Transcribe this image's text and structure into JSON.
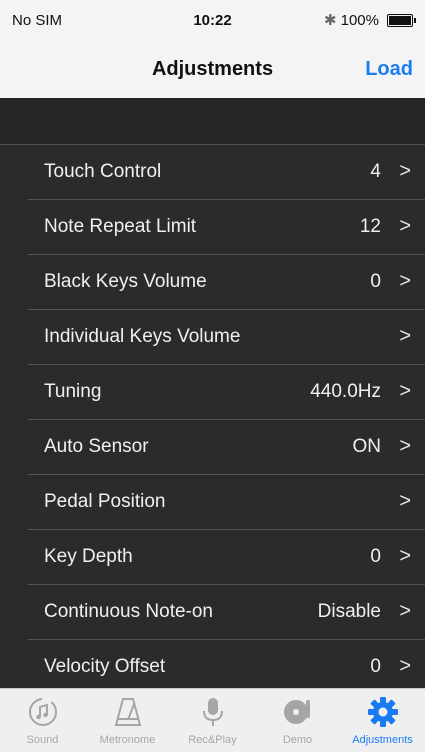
{
  "status_bar": {
    "carrier": "No SIM",
    "time": "10:22",
    "bluetooth": "✱",
    "battery_text": "100%",
    "battery_level": 1.0
  },
  "nav": {
    "title": "Adjustments",
    "action": "Load"
  },
  "settings": [
    {
      "label": "Touch Control",
      "value": "4"
    },
    {
      "label": "Note Repeat Limit",
      "value": "12"
    },
    {
      "label": "Black Keys Volume",
      "value": "0"
    },
    {
      "label": "Individual Keys Volume",
      "value": ""
    },
    {
      "label": "Tuning",
      "value": "440.0Hz"
    },
    {
      "label": "Auto Sensor",
      "value": "ON"
    },
    {
      "label": "Pedal Position",
      "value": ""
    },
    {
      "label": "Key Depth",
      "value": "0"
    },
    {
      "label": "Continuous Note-on",
      "value": "Disable"
    },
    {
      "label": "Velocity Offset",
      "value": "0"
    }
  ],
  "chevron": ">",
  "tabs": [
    {
      "label": "Sound",
      "icon": "music-note-icon"
    },
    {
      "label": "Metronome",
      "icon": "metronome-icon"
    },
    {
      "label": "Rec&Play",
      "icon": "microphone-icon"
    },
    {
      "label": "Demo",
      "icon": "vinyl-record-icon"
    },
    {
      "label": "Adjustments",
      "icon": "gear-icon",
      "active": true
    }
  ],
  "colors": {
    "accent": "#1a7cf5",
    "list_bg": "#2b2b2b",
    "inactive_tab": "#a6a6a6"
  }
}
